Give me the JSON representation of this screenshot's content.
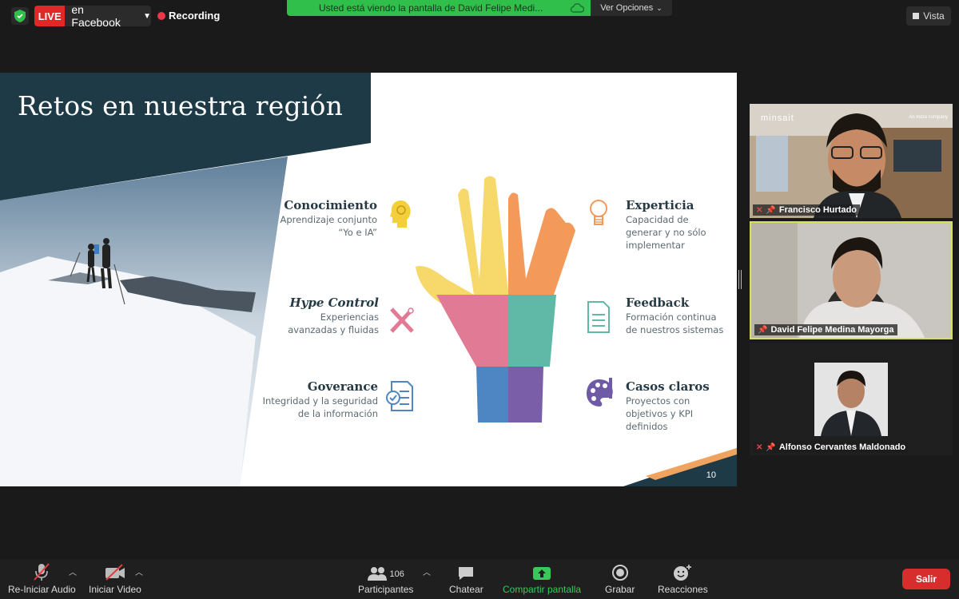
{
  "top_bar": {
    "live_tag": "LIVE",
    "live_destination": "en Facebook",
    "recording_label": "Recording",
    "share_banner": "Usted está viendo la pantalla de David Felipe Medi...",
    "view_options": "Ver Opciones",
    "view_button": "Vista"
  },
  "slide": {
    "title": "Retos en nuestra región",
    "page_number": "10",
    "left_items": [
      {
        "title": "Conocimiento",
        "sub1": "Aprendizaje conjunto",
        "sub2": "“Yo e IA”",
        "icon": "head-brain-icon"
      },
      {
        "title": "Hype Control",
        "sub1": "Experiencias",
        "sub2": "avanzadas y fluidas",
        "icon": "tools-icon"
      },
      {
        "title": "Goverance",
        "sub1": "Integridad y la seguridad",
        "sub2": "de la información",
        "icon": "document-check-icon"
      }
    ],
    "right_items": [
      {
        "title": "Experticia",
        "sub1": "Capacidad de",
        "sub2": "generar y no sólo",
        "sub3": "implementar",
        "icon": "lightbulb-icon"
      },
      {
        "title": "Feedback",
        "sub1": "Formación continua",
        "sub2": "de nuestros sistemas",
        "icon": "document-lines-icon"
      },
      {
        "title": "Casos claros",
        "sub1": "Proyectos con",
        "sub2": "objetivos y KPI",
        "sub3": "definidos",
        "icon": "palette-icon"
      }
    ]
  },
  "participants": [
    {
      "name": "Francisco Hurtado",
      "muted": true
    },
    {
      "name": "David Felipe Medina Mayorga",
      "muted": false,
      "active": true
    },
    {
      "name": "Alfonso Cervantes Maldonado",
      "muted": true
    }
  ],
  "participant_tile_brand": {
    "left": "minsait",
    "right": "An Indra company"
  },
  "toolbar": {
    "audio": "Re-Iniciar Audio",
    "video": "Iniciar Video",
    "participants": "Participantes",
    "participants_count": "106",
    "chat": "Chatear",
    "share": "Compartir pantalla",
    "record": "Grabar",
    "reactions": "Reacciones",
    "leave": "Salir"
  },
  "colors": {
    "live_red": "#e02828",
    "share_green": "#2fbf4a",
    "slide_dark": "#1e3a47",
    "active_border": "#d8e05a",
    "leave_red": "#d82d2d"
  }
}
